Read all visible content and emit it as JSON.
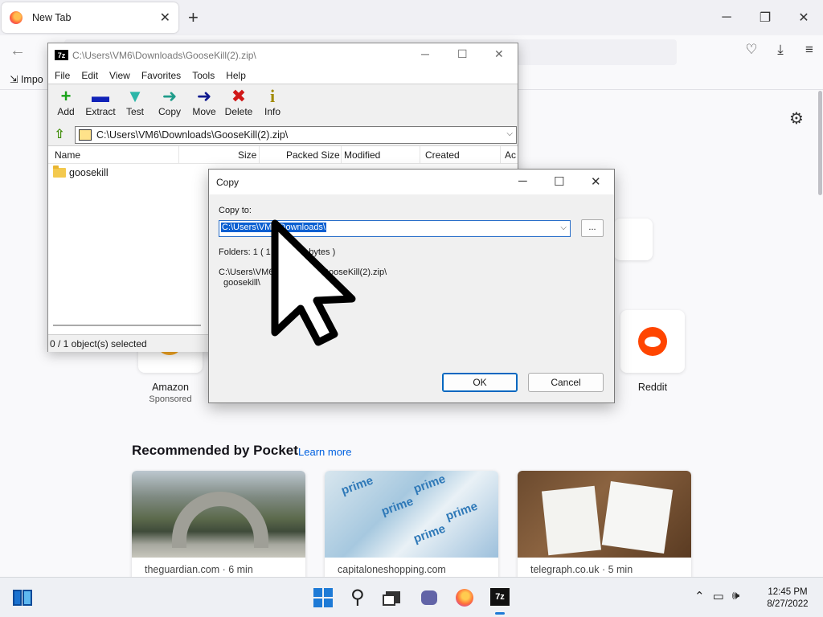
{
  "browser": {
    "tab_title": "New Tab",
    "tab_close": "✕",
    "new_tab": "+",
    "win_min": "─",
    "win_restore": "❐",
    "win_close": "✕",
    "bookmark_import": "Impo"
  },
  "newtab": {
    "shortcuts": [
      {
        "label": "Amazon",
        "sub": "Sponsored"
      },
      {
        "label": "Reddit",
        "sub": ""
      }
    ],
    "pocket_title": "Recommended by Pocket",
    "pocket_link": "Learn more",
    "cards": [
      {
        "source": "theguardian.com · 6 min"
      },
      {
        "source": "capitaloneshopping.com"
      },
      {
        "source": "telegraph.co.uk · 5 min"
      }
    ],
    "prime_word": "prime"
  },
  "sevenzip": {
    "title": "C:\\Users\\VM6\\Downloads\\GooseKill(2).zip\\",
    "menu": [
      "File",
      "Edit",
      "View",
      "Favorites",
      "Tools",
      "Help"
    ],
    "toolbar": [
      {
        "label": "Add",
        "glyph": "+",
        "color": "#1aa31a"
      },
      {
        "label": "Extract",
        "glyph": "▬",
        "color": "#1022b8"
      },
      {
        "label": "Test",
        "glyph": "▼",
        "color": "#2bb6a8"
      },
      {
        "label": "Copy",
        "glyph": "➜",
        "color": "#1f9c8a"
      },
      {
        "label": "Move",
        "glyph": "➜",
        "color": "#101a8f"
      },
      {
        "label": "Delete",
        "glyph": "✖",
        "color": "#d01818"
      },
      {
        "label": "Info",
        "glyph": "i",
        "color": "#a08a00"
      }
    ],
    "path": "C:\\Users\\VM6\\Downloads\\GooseKill(2).zip\\",
    "columns": [
      "Name",
      "Size",
      "Packed Size",
      "Modified",
      "Created",
      "Ac"
    ],
    "rows": [
      {
        "name": "goosekill"
      }
    ],
    "status": "0 / 1 object(s) selected"
  },
  "copy_dialog": {
    "title": "Copy",
    "copy_to_label": "Copy to:",
    "destination": "C:\\Users\\VM6\\Downloads\\",
    "folders_info_a": "Folders: 1    ( 1",
    "folders_info_b": "514 bytes )",
    "source_line1_a": "C:\\Users\\VM6",
    "source_line1_b": "GooseKill(2).zip\\",
    "source_line2": "goosekill\\",
    "browse_label": "...",
    "ok_label": "OK",
    "cancel_label": "Cancel"
  },
  "taskbar": {
    "time": "12:45 PM",
    "date": "8/27/2022",
    "sz_icon_text": "7z"
  },
  "colors": {
    "accent": "#0067c0",
    "selection": "#0a5fd1",
    "reddit": "#ff4500",
    "pocket_link": "#0061e0"
  }
}
